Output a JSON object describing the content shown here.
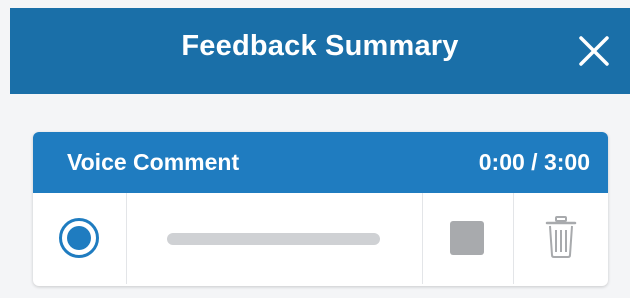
{
  "header": {
    "title": "Feedback Summary",
    "close_icon": "close-icon"
  },
  "voice_comment": {
    "title": "Voice Comment",
    "time_display": "0:00 / 3:00",
    "elapsed": "0:00",
    "duration": "3:00",
    "progress_fraction": 0,
    "icons": {
      "record": "record-icon",
      "stop": "stop-icon",
      "delete": "trash-icon"
    }
  },
  "colors": {
    "header_bg": "#1a6fa8",
    "card_header_bg": "#1f7cc0",
    "accent": "#1f7cc0",
    "disabled_gray": "#a8aaad",
    "track_gray": "#cfd1d4"
  }
}
